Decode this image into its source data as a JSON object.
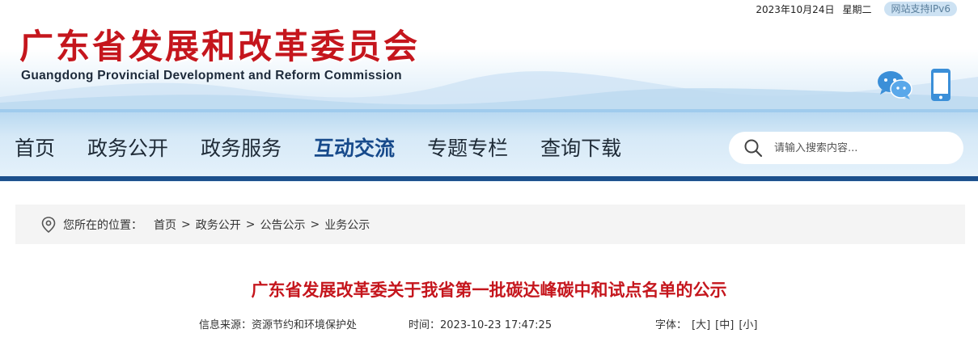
{
  "top_info": {
    "date": "2023年10月24日",
    "weekday": "星期二",
    "ipv6": "网站支持IPv6"
  },
  "header": {
    "title": "广东省发展和改革委员会",
    "subtitle": "Guangdong Provincial Development and Reform Commission"
  },
  "nav": {
    "items": [
      {
        "label": "首页"
      },
      {
        "label": "政务公开"
      },
      {
        "label": "政务服务"
      },
      {
        "label": "互动交流"
      },
      {
        "label": "专题专栏"
      },
      {
        "label": "查询下载"
      }
    ],
    "active_index": 3
  },
  "search": {
    "placeholder": "请输入搜索内容..."
  },
  "breadcrumb": {
    "label": "您所在的位置：",
    "items": [
      "首页",
      "政务公开",
      "公告公示",
      "业务公示"
    ],
    "separator": ">"
  },
  "article": {
    "title": "广东省发展改革委关于我省第一批碳达峰碳中和试点名单的公示",
    "source_label": "信息来源：",
    "source": "资源节约和环境保护处",
    "time_label": "时间：",
    "time": "2023-10-23 17:47:25",
    "fontsize_label": "字体：",
    "fontsize_options": [
      "[大]",
      "[中]",
      "[小]"
    ]
  },
  "colors": {
    "brand_red": "#c5161d",
    "nav_dark_blue": "#1b4f8c",
    "active_nav": "#174a8b"
  }
}
